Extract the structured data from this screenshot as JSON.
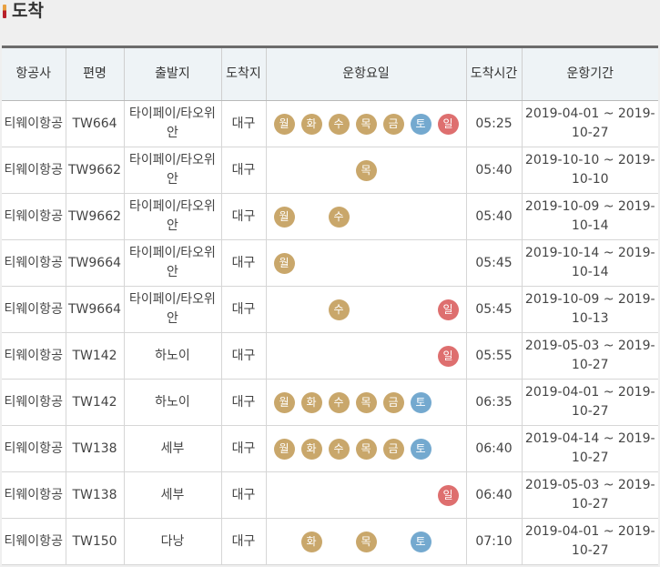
{
  "page_title": "도착",
  "colors": {
    "weekday": "#c9a76b",
    "saturday": "#74a9cf",
    "sunday": "#de6f6f",
    "header_bg": "#eef3f6"
  },
  "columns": [
    "항공사",
    "편명",
    "출발지",
    "도착지",
    "운항요일",
    "도착시간",
    "운항기간"
  ],
  "rows": [
    {
      "airline": "티웨이항공",
      "flight": "TW664",
      "origin": "타이페이/타오위안",
      "dest": "대구",
      "days": [
        "월",
        "화",
        "수",
        "목",
        "금",
        "토",
        "일"
      ],
      "time": "05:25",
      "period": "2019-04-01 ~ 2019-10-27"
    },
    {
      "airline": "티웨이항공",
      "flight": "TW9662",
      "origin": "타이페이/타오위안",
      "dest": "대구",
      "days": [
        "",
        "",
        "",
        "목",
        "",
        "",
        ""
      ],
      "time": "05:40",
      "period": "2019-10-10 ~ 2019-10-10"
    },
    {
      "airline": "티웨이항공",
      "flight": "TW9662",
      "origin": "타이페이/타오위안",
      "dest": "대구",
      "days": [
        "월",
        "",
        "수",
        "",
        "",
        "",
        ""
      ],
      "time": "05:40",
      "period": "2019-10-09 ~ 2019-10-14"
    },
    {
      "airline": "티웨이항공",
      "flight": "TW9664",
      "origin": "타이페이/타오위안",
      "dest": "대구",
      "days": [
        "월",
        "",
        "",
        "",
        "",
        "",
        ""
      ],
      "time": "05:45",
      "period": "2019-10-14 ~ 2019-10-14"
    },
    {
      "airline": "티웨이항공",
      "flight": "TW9664",
      "origin": "타이페이/타오위안",
      "dest": "대구",
      "days": [
        "",
        "",
        "수",
        "",
        "",
        "",
        "일"
      ],
      "time": "05:45",
      "period": "2019-10-09 ~ 2019-10-13"
    },
    {
      "airline": "티웨이항공",
      "flight": "TW142",
      "origin": "하노이",
      "dest": "대구",
      "days": [
        "",
        "",
        "",
        "",
        "",
        "",
        "일"
      ],
      "time": "05:55",
      "period": "2019-05-03 ~ 2019-10-27"
    },
    {
      "airline": "티웨이항공",
      "flight": "TW142",
      "origin": "하노이",
      "dest": "대구",
      "days": [
        "월",
        "화",
        "수",
        "목",
        "금",
        "토",
        ""
      ],
      "time": "06:35",
      "period": "2019-04-01 ~ 2019-10-27"
    },
    {
      "airline": "티웨이항공",
      "flight": "TW138",
      "origin": "세부",
      "dest": "대구",
      "days": [
        "월",
        "화",
        "수",
        "목",
        "금",
        "토",
        ""
      ],
      "time": "06:40",
      "period": "2019-04-14 ~ 2019-10-27"
    },
    {
      "airline": "티웨이항공",
      "flight": "TW138",
      "origin": "세부",
      "dest": "대구",
      "days": [
        "",
        "",
        "",
        "",
        "",
        "",
        "일"
      ],
      "time": "06:40",
      "period": "2019-05-03 ~ 2019-10-27"
    },
    {
      "airline": "티웨이항공",
      "flight": "TW150",
      "origin": "다낭",
      "dest": "대구",
      "days": [
        "",
        "화",
        "",
        "목",
        "",
        "토",
        ""
      ],
      "time": "07:10",
      "period": "2019-04-01 ~ 2019-10-27"
    }
  ]
}
